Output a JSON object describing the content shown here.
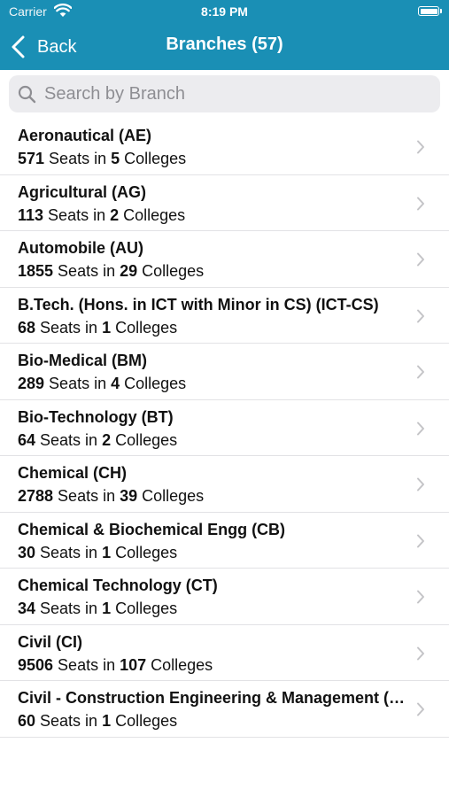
{
  "status_bar": {
    "carrier": "Carrier",
    "time": "8:19 PM"
  },
  "nav": {
    "back_label": "Back",
    "title": "Branches (57)"
  },
  "search": {
    "placeholder": "Search by Branch",
    "value": ""
  },
  "branches": [
    {
      "name": "Aeronautical (AE)",
      "seats": "571",
      "seats_suffix": " Seats in ",
      "colleges": "5",
      "colleges_suffix": " Colleges"
    },
    {
      "name": "Agricultural (AG)",
      "seats": "113",
      "seats_suffix": " Seats in ",
      "colleges": "2",
      "colleges_suffix": " Colleges"
    },
    {
      "name": "Automobile (AU)",
      "seats": "1855",
      "seats_suffix": " Seats in ",
      "colleges": "29",
      "colleges_suffix": " Colleges"
    },
    {
      "name": "B.Tech. (Hons. in ICT with Minor in CS) (ICT-CS)",
      "seats": "68",
      "seats_suffix": " Seats in ",
      "colleges": "1",
      "colleges_suffix": " Colleges"
    },
    {
      "name": "Bio-Medical (BM)",
      "seats": "289",
      "seats_suffix": " Seats in ",
      "colleges": "4",
      "colleges_suffix": " Colleges"
    },
    {
      "name": "Bio-Technology (BT)",
      "seats": "64",
      "seats_suffix": " Seats in ",
      "colleges": "2",
      "colleges_suffix": " Colleges"
    },
    {
      "name": "Chemical (CH)",
      "seats": "2788",
      "seats_suffix": " Seats in ",
      "colleges": "39",
      "colleges_suffix": " Colleges"
    },
    {
      "name": "Chemical & Biochemical Engg (CB)",
      "seats": "30",
      "seats_suffix": " Seats in ",
      "colleges": "1",
      "colleges_suffix": " Colleges"
    },
    {
      "name": "Chemical Technology (CT)",
      "seats": "34",
      "seats_suffix": " Seats in ",
      "colleges": "1",
      "colleges_suffix": " Colleges"
    },
    {
      "name": "Civil (CI)",
      "seats": "9506",
      "seats_suffix": " Seats in ",
      "colleges": "107",
      "colleges_suffix": " Colleges"
    },
    {
      "name": "Civil - Construction Engineering & Management (CM)",
      "seats": "60",
      "seats_suffix": " Seats in ",
      "colleges": "1",
      "colleges_suffix": " Colleges"
    }
  ],
  "colors": {
    "header": "#1a8fb5",
    "search_bg": "#ececef",
    "chevron": "#c4c4c7"
  },
  "icons": {
    "wifi": "wifi-icon",
    "battery": "battery-icon",
    "back": "chevron-left-icon",
    "search": "search-icon",
    "row_disclosure": "chevron-right-icon"
  }
}
